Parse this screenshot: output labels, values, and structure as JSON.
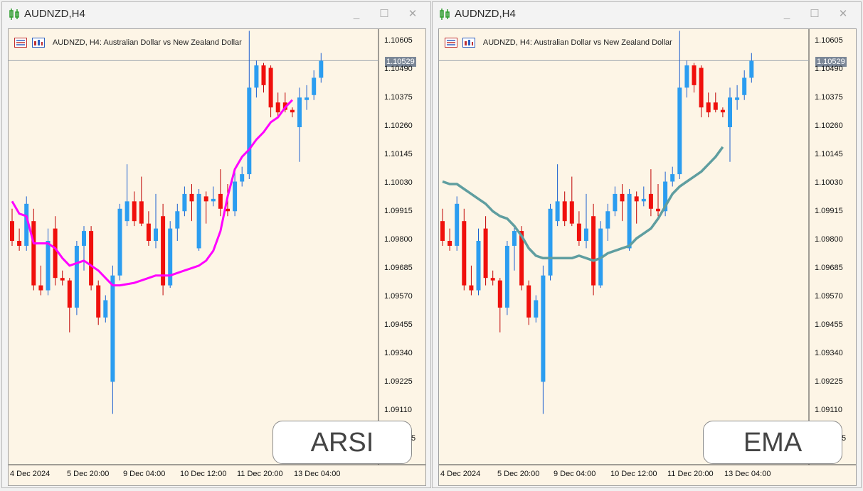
{
  "windows": [
    {
      "title": "AUDNZD,H4",
      "chart_header": "AUDNZD, H4:  Australian Dollar vs New Zealand Dollar",
      "current_price": "1.10529",
      "indicator_label": "ARSI",
      "indicator_color": "#ff00ff",
      "price_labels": [
        "1.10605",
        "1.10490",
        "1.10375",
        "1.10260",
        "1.10145",
        "1.10030",
        "1.09915",
        "1.09800",
        "1.09685",
        "1.09570",
        "1.09455",
        "1.09340",
        "1.09225",
        "1.09110",
        "5"
      ],
      "date_labels": [
        "4 Dec 2024",
        "5 Dec 20:00",
        "9 Dec 04:00",
        "10 Dec 12:00",
        "11 Dec 20:00",
        "13 Dec 04:00"
      ]
    },
    {
      "title": "AUDNZD,H4",
      "chart_header": "AUDNZD, H4:  Australian Dollar vs New Zealand Dollar",
      "current_price": "1.10529",
      "indicator_label": "EMA",
      "indicator_color": "#5f9ea0",
      "price_labels": [
        "1.10605",
        "1.10490",
        "1.10375",
        "1.10260",
        "1.10145",
        "1.10030",
        "1.09915",
        "1.09800",
        "1.09685",
        "1.09570",
        "1.09455",
        "1.09340",
        "1.09225",
        "1.09110",
        "5"
      ],
      "date_labels": [
        "4 Dec 2024",
        "5 Dec 20:00",
        "9 Dec 04:00",
        "10 Dec 12:00",
        "11 Dec 20:00",
        "13 Dec 04:00"
      ]
    }
  ],
  "window_controls": {
    "minimize": "_",
    "maximize": "☐",
    "close": "✕"
  },
  "colors": {
    "bull": "#2b9df0",
    "bear": "#f0100c",
    "doji": "#22cc22",
    "background": "#fdf5e6"
  },
  "chart_data": {
    "type": "candlestick",
    "symbol": "AUDNZD",
    "timeframe": "H4",
    "ylim": [
      1.09,
      1.107
    ],
    "current_price": 1.10529,
    "candles": [
      {
        "o": 1.0988,
        "h": 1.0993,
        "l": 1.0978,
        "c": 1.098
      },
      {
        "o": 1.098,
        "h": 1.0985,
        "l": 1.0976,
        "c": 1.0978
      },
      {
        "o": 1.0978,
        "h": 1.0998,
        "l": 1.0976,
        "c": 1.0995
      },
      {
        "o": 1.0988,
        "h": 1.0993,
        "l": 1.096,
        "c": 1.0962
      },
      {
        "o": 1.0962,
        "h": 1.097,
        "l": 1.0958,
        "c": 1.096
      },
      {
        "o": 1.096,
        "h": 1.0985,
        "l": 1.0958,
        "c": 1.098
      },
      {
        "o": 1.0985,
        "h": 1.099,
        "l": 1.0962,
        "c": 1.0965
      },
      {
        "o": 1.0965,
        "h": 1.0968,
        "l": 1.0962,
        "c": 1.0964
      },
      {
        "o": 1.0964,
        "h": 1.0965,
        "l": 1.0943,
        "c": 1.0953
      },
      {
        "o": 1.0953,
        "h": 1.098,
        "l": 1.095,
        "c": 1.0978
      },
      {
        "o": 1.0978,
        "h": 1.0986,
        "l": 1.0968,
        "c": 1.0984
      },
      {
        "o": 1.0984,
        "h": 1.0986,
        "l": 1.096,
        "c": 1.0962
      },
      {
        "o": 1.0962,
        "h": 1.0964,
        "l": 1.0946,
        "c": 1.0949
      },
      {
        "o": 1.0949,
        "h": 1.0958,
        "l": 1.0947,
        "c": 1.0956
      },
      {
        "o": 1.0923,
        "h": 1.097,
        "l": 1.091,
        "c": 1.0966
      },
      {
        "o": 1.0966,
        "h": 1.0995,
        "l": 1.0964,
        "c": 1.0993
      },
      {
        "o": 1.0988,
        "h": 1.1011,
        "l": 1.0986,
        "c": 1.0996
      },
      {
        "o": 1.0996,
        "h": 1.1,
        "l": 1.0986,
        "c": 1.0988
      },
      {
        "o": 1.0996,
        "h": 1.1006,
        "l": 1.0986,
        "c": 1.0987
      },
      {
        "o": 1.0987,
        "h": 1.0992,
        "l": 1.0978,
        "c": 1.098
      },
      {
        "o": 1.098,
        "h": 1.0999,
        "l": 1.0977,
        "c": 1.0985
      },
      {
        "o": 1.099,
        "h": 1.0995,
        "l": 1.0958,
        "c": 1.0962
      },
      {
        "o": 1.0962,
        "h": 1.0988,
        "l": 1.0961,
        "c": 1.0985
      },
      {
        "o": 1.0985,
        "h": 1.0995,
        "l": 1.098,
        "c": 1.0992
      },
      {
        "o": 1.0992,
        "h": 1.1002,
        "l": 1.099,
        "c": 1.0999
      },
      {
        "o": 1.0999,
        "h": 1.1003,
        "l": 1.0988,
        "c": 1.0996
      },
      {
        "o": 1.0977,
        "h": 1.1001,
        "l": 1.0976,
        "c": 1.0999
      },
      {
        "o": 1.0998,
        "h": 1.1,
        "l": 1.0987,
        "c": 1.0996
      },
      {
        "o": 1.0996,
        "h": 1.1002,
        "l": 1.0994,
        "c": 1.0997
      },
      {
        "o": 1.0999,
        "h": 1.1009,
        "l": 1.099,
        "c": 1.0993
      },
      {
        "o": 1.0993,
        "h": 1.1003,
        "l": 1.099,
        "c": 1.0992
      },
      {
        "o": 1.0992,
        "h": 1.1008,
        "l": 1.099,
        "c": 1.1004
      },
      {
        "o": 1.1004,
        "h": 1.101,
        "l": 1.1002,
        "c": 1.1007
      },
      {
        "o": 1.1007,
        "h": 1.1065,
        "l": 1.1005,
        "c": 1.1042
      },
      {
        "o": 1.1042,
        "h": 1.1053,
        "l": 1.1038,
        "c": 1.1051
      },
      {
        "o": 1.1051,
        "h": 1.1052,
        "l": 1.104,
        "c": 1.1043
      },
      {
        "o": 1.105,
        "h": 1.1051,
        "l": 1.103,
        "c": 1.1034
      },
      {
        "o": 1.1036,
        "h": 1.104,
        "l": 1.103,
        "c": 1.1032
      },
      {
        "o": 1.1036,
        "h": 1.104,
        "l": 1.1032,
        "c": 1.1033
      },
      {
        "o": 1.1033,
        "h": 1.1034,
        "l": 1.103,
        "c": 1.1032
      },
      {
        "o": 1.1026,
        "h": 1.1042,
        "l": 1.1012,
        "c": 1.1038
      },
      {
        "o": 1.1037,
        "h": 1.1043,
        "l": 1.1033,
        "c": 1.1038
      },
      {
        "o": 1.1039,
        "h": 1.1049,
        "l": 1.1037,
        "c": 1.1046
      },
      {
        "o": 1.1046,
        "h": 1.1056,
        "l": 1.1044,
        "c": 1.10529
      }
    ],
    "arsi": [
      1.0996,
      1.0991,
      1.099,
      1.0979,
      1.0979,
      1.0979,
      1.0977,
      1.0973,
      1.097,
      1.0971,
      1.0972,
      1.097,
      1.0968,
      1.0965,
      1.0962,
      1.0962,
      1.09625,
      1.0963,
      1.0964,
      1.0965,
      1.0966,
      1.0966,
      1.0966,
      1.0967,
      1.0968,
      1.0969,
      1.097,
      1.0972,
      1.0976,
      1.0984,
      1.0998,
      1.1009,
      1.1014,
      1.1017,
      1.1021,
      1.1024,
      1.1028,
      1.103,
      1.1034,
      1.1037
    ],
    "ema": [
      1.1004,
      1.1003,
      1.1003,
      1.1001,
      1.0999,
      1.0997,
      1.0995,
      1.0992,
      1.099,
      1.0989,
      1.0986,
      1.0982,
      1.0977,
      1.0974,
      1.0973,
      1.0973,
      1.0973,
      1.0973,
      1.0973,
      1.0974,
      1.0973,
      1.0972,
      1.0973,
      1.0975,
      1.0976,
      1.0977,
      1.0978,
      1.0981,
      1.0983,
      1.0985,
      1.0989,
      1.0994,
      1.0999,
      1.1002,
      1.1004,
      1.1006,
      1.1008,
      1.1011,
      1.1014,
      1.1018
    ]
  }
}
